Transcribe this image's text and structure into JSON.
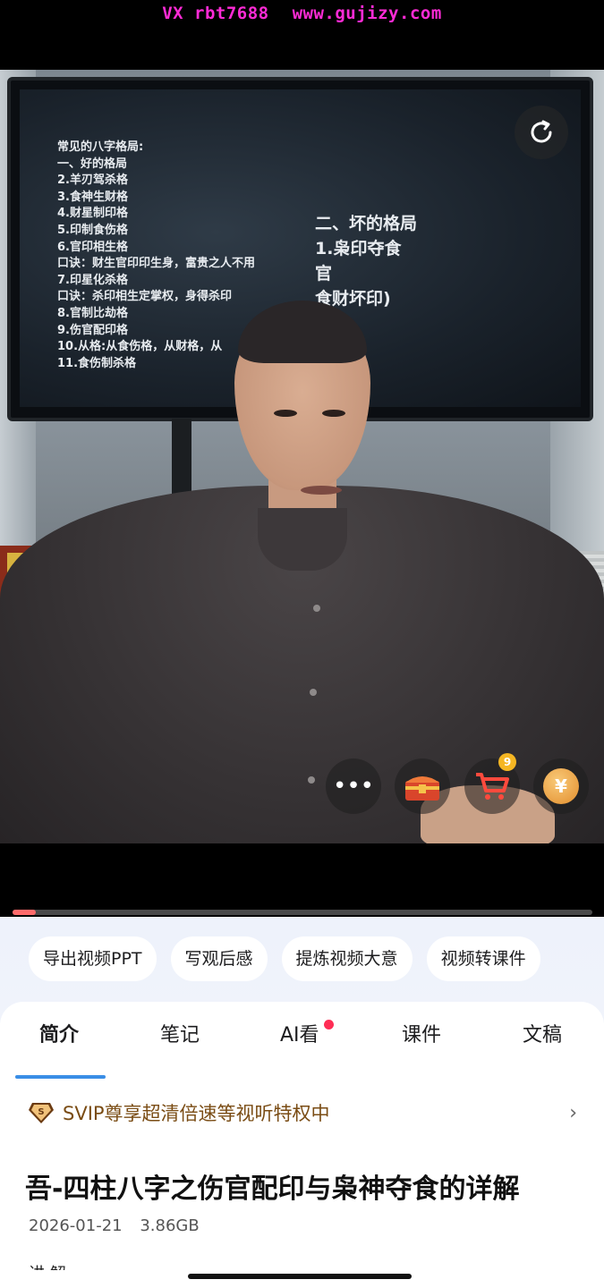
{
  "watermark": {
    "id": "VX rbt7688",
    "site": "www.gujizy.com"
  },
  "video": {
    "slide_left": [
      "常见的八字格局:",
      "一、好的格局",
      "2.羊刃驾杀格",
      "3.食神生财格",
      "4.财星制印格",
      "5.印制食伤格",
      "6.官印相生格",
      "口诀：财生官印印生身，富贵之人不用",
      "7.印星化杀格",
      "口诀：杀印相生定掌权，身得杀印",
      "8.官制比劫格",
      "9.伤官配印格",
      "10.从格:从食伤格，从财格，从",
      "11.食伤制杀格"
    ],
    "slide_right": [
      "二、坏的格局",
      "1.枭印夺食",
      "官",
      "食财坏印)"
    ],
    "replay_icon": "replay-icon",
    "overlay_buttons": {
      "more_icon": "more-icon",
      "gift_icon": "treasure-chest-icon",
      "cart_icon": "shopping-cart-icon",
      "cart_badge": "9",
      "coin_label": "¥"
    },
    "progress": 0.04
  },
  "actions": {
    "chips": [
      "导出视频PPT",
      "写观后感",
      "提炼视频大意",
      "视频转课件"
    ]
  },
  "tabs": {
    "items": [
      "简介",
      "笔记",
      "AI看",
      "课件",
      "文稿"
    ],
    "active_index": 0
  },
  "svip": {
    "icon": "svip-diamond-icon",
    "text": "SVIP尊享超清倍速等视听特权中",
    "chevron": "›"
  },
  "detail": {
    "title": "吾-四柱八字之伤官配印与枭神夺食的详解",
    "date": "2026-01-21",
    "size": "3.86GB",
    "cut_text": "讲 解"
  },
  "colors": {
    "watermark": "#ff2bd6",
    "tab_underline": "#3a8ee6",
    "progress_fill": "#ff6b6b",
    "svip_text": "#7a4c14"
  }
}
